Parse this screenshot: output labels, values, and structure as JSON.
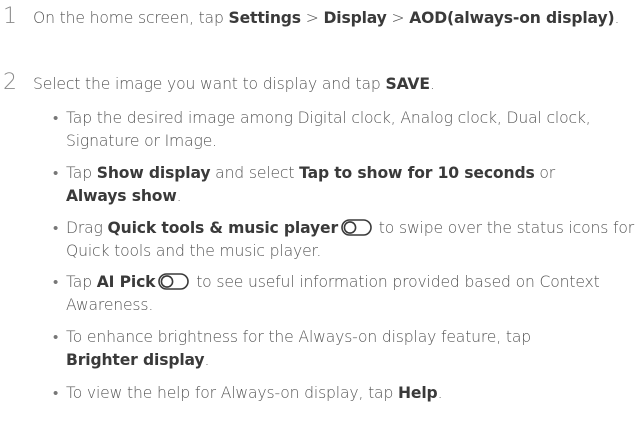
{
  "steps": [
    {
      "number": "1",
      "text_1": "On the home screen, tap ",
      "settings": "Settings",
      "sep_1": " > ",
      "display": "Display",
      "sep_2": " > ",
      "aod": "AOD(always-on display)",
      "end": "."
    },
    {
      "number": "2",
      "text_1": "Select the image you want to display and tap ",
      "save": "SAVE",
      "end": "."
    }
  ],
  "bullets": [
    {
      "glyph": "•",
      "text": "Tap the desired image among Digital clock, Analog clock, Dual clock, Signature or Image."
    },
    {
      "glyph": "•",
      "t1": "Tap ",
      "b1": "Show display",
      "t2": " and select ",
      "b2": "Tap to show for 10 seconds",
      "t3": " or ",
      "b3": "Always show",
      "t4": "."
    },
    {
      "glyph": "•",
      "t1": "Drag ",
      "b1": "Quick tools & music player",
      "toggle_icon": "toggle-switch-icon",
      "t2": " to swipe over the status icons for Quick tools and the music player."
    },
    {
      "glyph": "•",
      "t1": "Tap ",
      "b1": "AI Pick",
      "toggle_icon": "toggle-switch-icon",
      "t2": " to see useful information provided based on Context Awareness."
    },
    {
      "glyph": "•",
      "t1": "To enhance brightness for the Always-on display feature, tap ",
      "b1": "Brighter display",
      "t2": "."
    },
    {
      "glyph": "•",
      "t1": "To view the help for Always-on display, tap ",
      "b1": "Help",
      "t2": "."
    }
  ]
}
